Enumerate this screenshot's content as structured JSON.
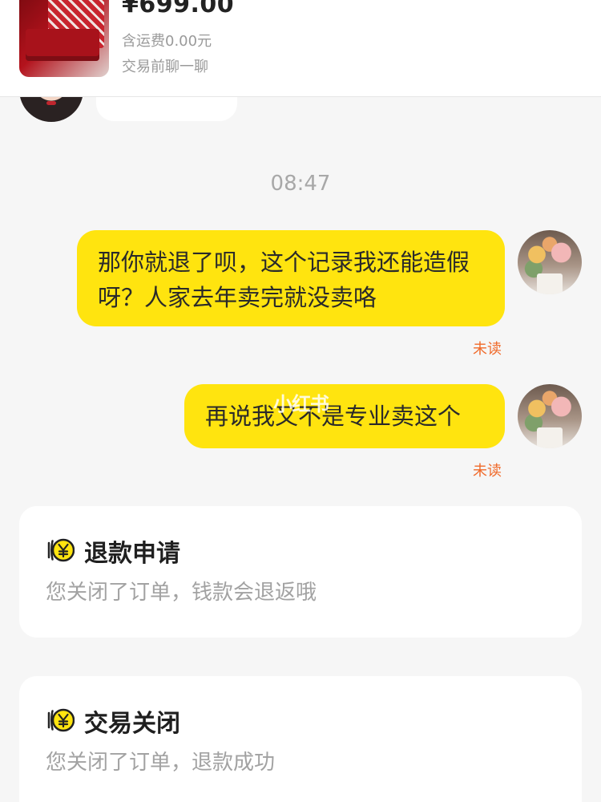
{
  "product": {
    "price": "¥699.00",
    "shipping": "含运费0.00元",
    "chat_before_trade": "交易前聊一聊"
  },
  "messages": {
    "timestamp": "08:47",
    "outgoing": [
      {
        "text": "那你就退了呗，这个记录我还能造假呀？人家去年卖完就没卖咯",
        "status": "未读"
      },
      {
        "text": "再说我又不是专业卖这个",
        "status": "未读"
      }
    ],
    "bubble_color": "#ffe40f",
    "unread_color": "#f06a2a"
  },
  "cards": {
    "refund": {
      "icon": "yen-coin-icon",
      "title": "退款申请",
      "body": "您关闭了订单，钱款会退返哦"
    },
    "closed": {
      "icon": "yen-coin-icon",
      "title": "交易关闭",
      "body": "您关闭了订单，退款成功"
    }
  },
  "watermark": "小红书"
}
